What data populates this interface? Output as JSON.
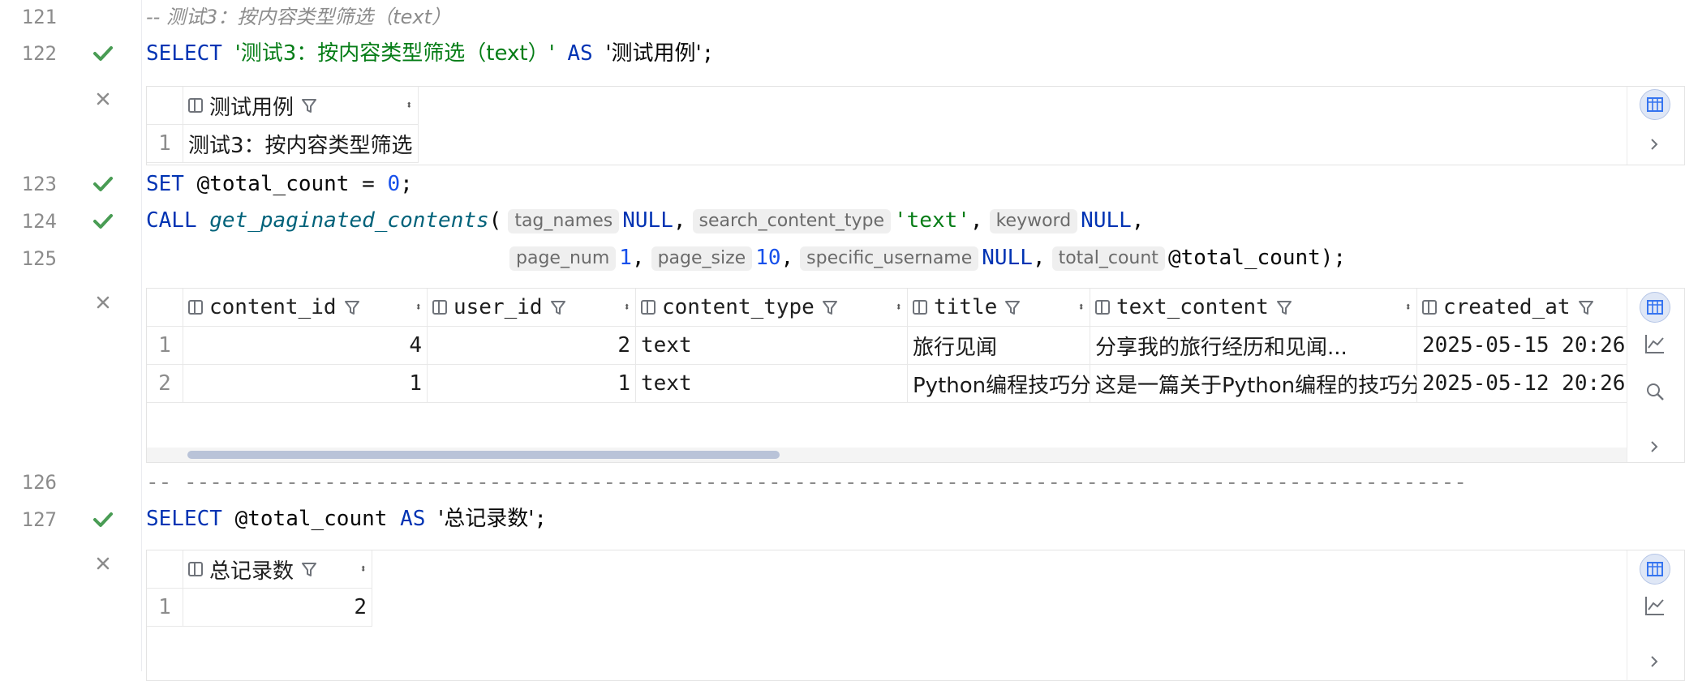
{
  "lines": {
    "l121": {
      "num": "121",
      "comment": "-- 测试3：按内容类型筛选（text）"
    },
    "l122": {
      "num": "122",
      "kw_select": "SELECT",
      "str_value": "'测试3：按内容类型筛选（text）'",
      "kw_as": "AS",
      "alias": "'测试用例'",
      "end": ";"
    },
    "l123": {
      "num": "123",
      "kw_set": "SET",
      "var": "@total_count",
      "eq": "=",
      "value": "0",
      "end": ";"
    },
    "l124": {
      "num": "124",
      "kw_call": "CALL",
      "fn": "get_paginated_contents",
      "paren": "(",
      "hint_tag_names": "tag_names",
      "v_tag_names": "NULL",
      "hint_search_content_type": "search_content_type",
      "v_search_content_type": "'text'",
      "hint_keyword": "keyword",
      "v_keyword": "NULL",
      "comma": ","
    },
    "l125": {
      "num": "125",
      "hint_page_num": "page_num",
      "v_page_num": "1",
      "hint_page_size": "page_size",
      "v_page_size": "10",
      "hint_specific_username": "specific_username",
      "v_specific_username": "NULL",
      "hint_total_count": "total_count",
      "v_total_count": "@total_count",
      "end": ");"
    },
    "l126": {
      "num": "126",
      "comment": "-- -----------------------------------------------------------------------------------------------------"
    },
    "l127": {
      "num": "127",
      "kw_select": "SELECT",
      "var": "@total_count",
      "kw_as": "AS",
      "alias": "'总记录数'",
      "end": ";"
    }
  },
  "result1": {
    "columns": [
      "测试用例"
    ],
    "rows": [
      {
        "rownum": "1",
        "cells": [
          "测试3：按内容类型筛选"
        ]
      }
    ]
  },
  "result2": {
    "columns": [
      "content_id",
      "user_id",
      "content_type",
      "title",
      "text_content",
      "created_at"
    ],
    "rows": [
      {
        "rownum": "1",
        "cells": [
          "4",
          "2",
          "text",
          "旅行见闻",
          "分享我的旅行经历和见闻...",
          "2025-05-15 20:26"
        ]
      },
      {
        "rownum": "2",
        "cells": [
          "1",
          "1",
          "text",
          "Python编程技巧分",
          "这是一篇关于Python编程的技巧分",
          "2025-05-12 20:26"
        ]
      }
    ]
  },
  "result3": {
    "columns": [
      "总记录数"
    ],
    "rows": [
      {
        "rownum": "1",
        "cells": [
          "2"
        ]
      }
    ]
  },
  "icons": {
    "success": "check-icon",
    "close": "close-icon",
    "table_view": "table-icon",
    "chart_view": "chart-icon",
    "search": "search-icon",
    "expand": "chevron-right-icon"
  },
  "colors": {
    "keyword": "#0033b3",
    "string": "#067d17",
    "number": "#1750eb",
    "check": "#499c54",
    "comment": "#8c8c8c"
  }
}
